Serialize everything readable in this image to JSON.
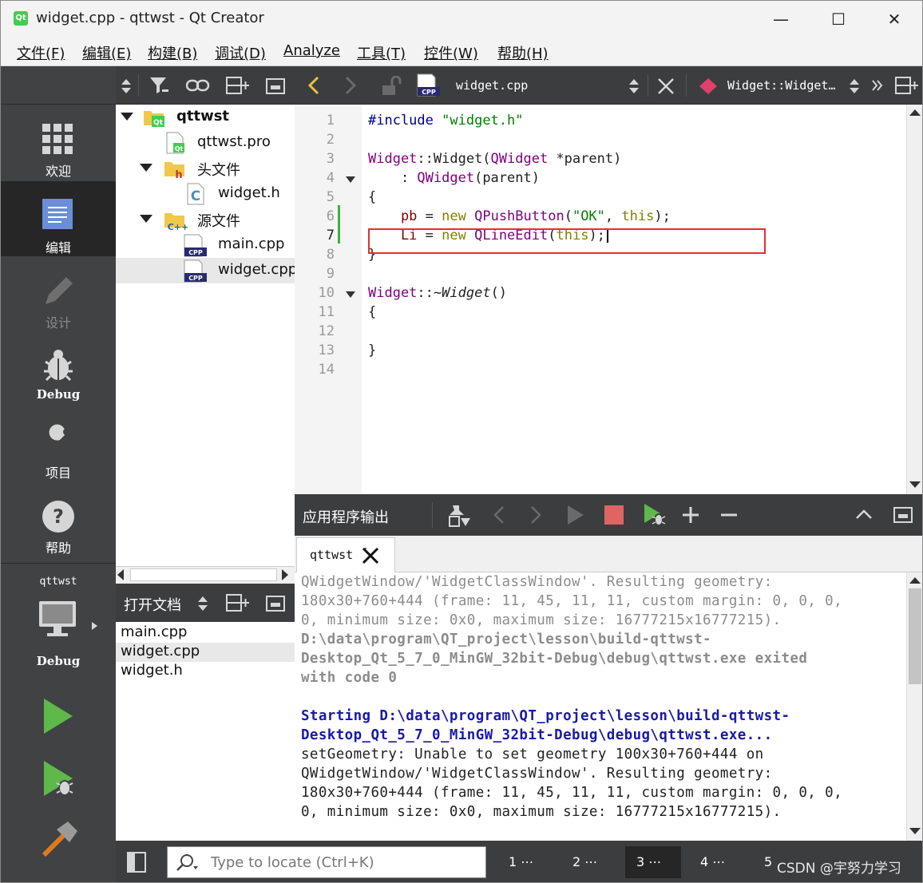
{
  "window": {
    "title": "widget.cpp - qttwst - Qt Creator",
    "logo": "Qt",
    "minimize": "—",
    "maximize": "☐",
    "close": "✕"
  },
  "menu": [
    "文件(F)",
    "编辑(E)",
    "构建(B)",
    "调试(D)",
    "Analyze",
    "工具(T)",
    "控件(W)",
    "帮助(H)"
  ],
  "modes": [
    {
      "label": "欢迎",
      "icon": "grid-icon"
    },
    {
      "label": "编辑",
      "icon": "edit-document-icon",
      "active": true
    },
    {
      "label": "设计",
      "icon": "pencil-icon",
      "disabled": true
    },
    {
      "label": "Debug",
      "icon": "bug-icon"
    },
    {
      "label": "项目",
      "icon": "wrench-icon"
    },
    {
      "label": "帮助",
      "icon": "help-icon"
    }
  ],
  "kit": {
    "project": "qttwst",
    "config": "Debug"
  },
  "tree": {
    "project": "qttwst",
    "pro_file": "qttwst.pro",
    "headers": "头文件",
    "header_file": "widget.h",
    "sources": "源文件",
    "source_files": [
      "main.cpp",
      "widget.cpp"
    ]
  },
  "open_documents": {
    "label": "打开文档",
    "files": [
      "main.cpp",
      "widget.cpp",
      "widget.h"
    ],
    "selected": 1
  },
  "editor": {
    "file": "widget.cpp",
    "symbol": "Widget::Widget…",
    "line_numbers": [
      "1",
      "2",
      "3",
      "4",
      "5",
      "6",
      "7",
      "8",
      "9",
      "10",
      "11",
      "12",
      "13",
      "14"
    ],
    "current_line": 7,
    "code": {
      "l1_pp": "#include",
      "l1_str": "\"widget.h\"",
      "l3_a": "Widget",
      "l3_b": "::Widget(",
      "l3_c": "QWidget",
      "l3_d": " *parent)",
      "l4_a": "    : ",
      "l4_b": "QWidget",
      "l4_c": "(parent)",
      "l5": "{",
      "l6_a": "    pb",
      "l6_b": " = ",
      "l6_c": "new",
      "l6_d": " ",
      "l6_e": "QPushButton",
      "l6_f": "(",
      "l6_g": "\"OK\"",
      "l6_h": ", ",
      "l6_i": "this",
      "l6_j": ");",
      "l7_a": "    Li",
      "l7_b": " = ",
      "l7_c": "new",
      "l7_d": " ",
      "l7_e": "QLineEdit",
      "l7_f": "(",
      "l7_g": "this",
      "l7_h": ");",
      "l8": "}",
      "l10_a": "Widget",
      "l10_b": "::~",
      "l10_c": "Widget",
      "l10_d": "()",
      "l11": "{",
      "l13": "}"
    }
  },
  "output": {
    "pane_title": "应用程序输出",
    "tab": "qttwst",
    "lines_gray": [
      "QWidgetWindow/'WidgetClassWindow'. Resulting geometry:",
      "180x30+760+444 (frame: 11, 45, 11, 11, custom margin: 0, 0, 0,",
      "0, minimum size: 0x0, maximum size: 16777215x16777215)."
    ],
    "lines_exit": [
      "D:\\data\\program\\QT_project\\lesson\\build-qttwst-",
      "Desktop_Qt_5_7_0_MinGW_32bit-Debug\\debug\\qttwst.exe exited",
      "with code 0"
    ],
    "lines_start": [
      "Starting D:\\data\\program\\QT_project\\lesson\\build-qttwst-",
      "Desktop_Qt_5_7_0_MinGW_32bit-Debug\\debug\\qttwst.exe..."
    ],
    "lines_normal": [
      "setGeometry: Unable to set geometry 100x30+760+444 on",
      "QWidgetWindow/'WidgetClassWindow'. Resulting geometry:",
      "180x30+760+444 (frame: 11, 45, 11, 11, custom margin: 0, 0, 0,",
      "0, minimum size: 0x0, maximum size: 16777215x16777215)."
    ]
  },
  "status": {
    "locator_placeholder": "Type to locate (Ctrl+K)",
    "tabs": [
      "1 ⋯",
      "2 ⋯",
      "3 ⋯",
      "4 ⋯",
      "5"
    ],
    "active_tab": 2,
    "watermark": "CSDN @宇努力学习"
  },
  "colors": {
    "accent_red": "#e03131",
    "run_green": "#5fb84a",
    "dark_panel": "#404244",
    "keyword": "#808000",
    "type": "#800080",
    "string": "#008000"
  }
}
